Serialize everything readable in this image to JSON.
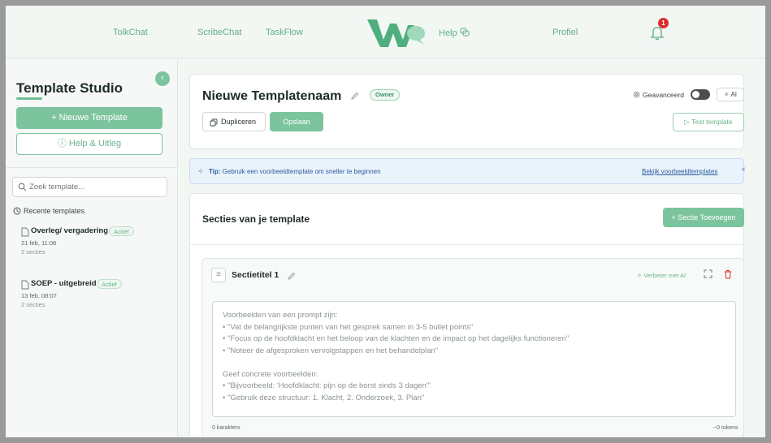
{
  "nav": {
    "links": [
      "TolkChat",
      "ScribeChat",
      "TaskFlow",
      "Help",
      "Profiel"
    ],
    "notification_count": "1"
  },
  "sidebar": {
    "title": "Template Studio",
    "new_template": "+ Nieuwe Template",
    "help": "Help & Uitleg",
    "search_placeholder": "Zoek template...",
    "recent_label": "Recente templates",
    "templates": [
      {
        "name": "Overleg/ vergadering",
        "badge": "Actief",
        "date": "21 feb, 11:08",
        "count": "2 secties"
      },
      {
        "name": "SOEP - uitgebreid",
        "badge": "Actief",
        "date": "13 feb, 08:07",
        "count": "2 secties"
      }
    ]
  },
  "header": {
    "title": "Nieuwe Templatenaam",
    "owner_badge": "Owner",
    "duplicate": "Dupliceren",
    "save": "Opslaan",
    "advanced_label": "Geavanceerd",
    "advanced_enabled": false,
    "ai_button": "AI",
    "test_button": "Test template"
  },
  "tip": {
    "label": "Tip:",
    "text": "Gebruik een voorbeeldtemplate om sneller te beginnen",
    "link": "Bekijk voorbeeldtemplates",
    "close": "×"
  },
  "sections": {
    "title": "Secties van je template",
    "add_button": "+ Sectie Toevoegen",
    "items": [
      {
        "title": "Sectietitel 1",
        "ai_improve": "Verbeter met AI",
        "placeholder_lines": [
          "Voorbeelden van een prompt zijn:",
          "• \"Vat de belangrijkste punten van het gesprek samen in 3-5 bullet points\"",
          "• \"Focus op de hoofdklacht en het beloop van de klachten en de impact op het dagelijks functioneren\"",
          "• \"Noteer de afgesproken vervolgstappen en het behandelplan\"",
          "",
          "Geef concrete voorbeelden:",
          "• \"Bijvoorbeeld: 'Hoofdklacht: pijn op de borst sinds 3 dagen'\"",
          "• \"Gebruik deze structuur: 1. Klacht, 2. Onderzoek, 3. Plan\""
        ],
        "char_count": "0 karakters",
        "token_count": "~0 tokens"
      }
    ]
  },
  "colors": {
    "accent": "#7cc49d",
    "danger": "#d92d2d",
    "tip_blue": "#2d5e9e"
  }
}
